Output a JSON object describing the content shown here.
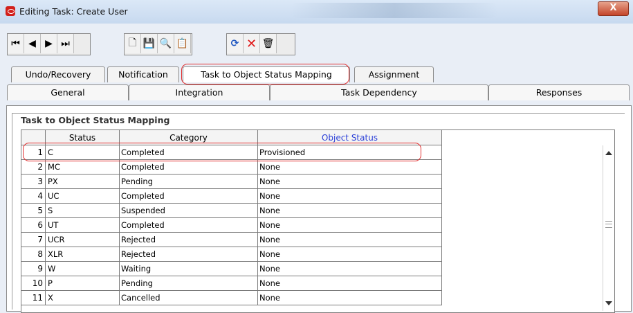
{
  "window": {
    "title": "Editing Task: Create User",
    "close_label": "X"
  },
  "toolbar": {
    "group1": [
      {
        "name": "first-record-icon",
        "glyph": "⏮"
      },
      {
        "name": "previous-record-icon",
        "glyph": "◀"
      },
      {
        "name": "next-record-icon",
        "glyph": "▶"
      },
      {
        "name": "last-record-icon",
        "glyph": "⏭"
      }
    ],
    "group2": [
      {
        "name": "new-document-icon",
        "glyph": "🗋"
      },
      {
        "name": "save-icon",
        "glyph": "💾"
      },
      {
        "name": "find-icon",
        "glyph": "🔍",
        "disabled": true
      },
      {
        "name": "clipboard-icon",
        "glyph": "📋"
      }
    ],
    "group3": [
      {
        "name": "refresh-icon",
        "glyph": "⟳"
      },
      {
        "name": "delete-icon",
        "glyph": "✕"
      },
      {
        "name": "trash-icon",
        "glyph": "🗑"
      }
    ]
  },
  "tabs": {
    "row1": [
      "Undo/Recovery",
      "Notification",
      "Task to Object Status Mapping",
      "Assignment"
    ],
    "row2": [
      "General",
      "Integration",
      "Task Dependency",
      "Responses"
    ],
    "selected": "Task to Object Status Mapping"
  },
  "section": {
    "title": "Task to Object Status Mapping"
  },
  "table": {
    "headers": [
      "Status",
      "Category",
      "Object Status"
    ],
    "rows": [
      {
        "n": "1",
        "status": "C",
        "category": "Completed",
        "object_status": "Provisioned"
      },
      {
        "n": "2",
        "status": "MC",
        "category": "Completed",
        "object_status": "None"
      },
      {
        "n": "3",
        "status": "PX",
        "category": "Pending",
        "object_status": "None"
      },
      {
        "n": "4",
        "status": "UC",
        "category": "Completed",
        "object_status": "None"
      },
      {
        "n": "5",
        "status": "S",
        "category": "Suspended",
        "object_status": "None"
      },
      {
        "n": "6",
        "status": "UT",
        "category": "Completed",
        "object_status": "None"
      },
      {
        "n": "7",
        "status": "UCR",
        "category": "Rejected",
        "object_status": "None"
      },
      {
        "n": "8",
        "status": "XLR",
        "category": "Rejected",
        "object_status": "None"
      },
      {
        "n": "9",
        "status": "W",
        "category": "Waiting",
        "object_status": "None"
      },
      {
        "n": "10",
        "status": "P",
        "category": "Pending",
        "object_status": "None"
      },
      {
        "n": "11",
        "status": "X",
        "category": "Cancelled",
        "object_status": "None"
      }
    ]
  },
  "colors": {
    "highlight": "#e23030",
    "link_header": "#2a3fd8",
    "close_button": "#c4452a"
  }
}
